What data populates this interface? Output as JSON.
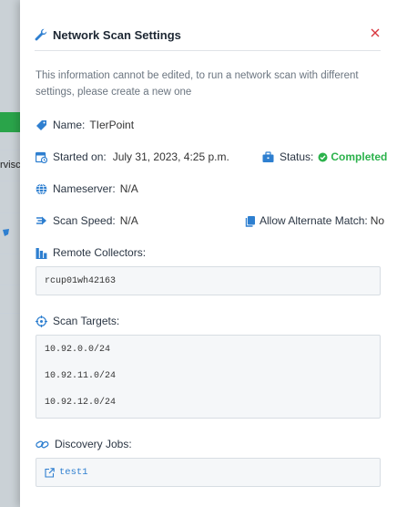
{
  "background": {
    "partial_text": "rvisc"
  },
  "panel": {
    "title": "Network Scan Settings",
    "close_glyph": "✕",
    "description": "This information cannot be edited, to run a network scan with different settings, please create a new one"
  },
  "fields": {
    "name": {
      "label": "Name:",
      "value": "TIerPoint"
    },
    "started_on": {
      "label": "Started on:",
      "value": "July 31, 2023, 4:25 p.m."
    },
    "status": {
      "label": "Status:",
      "value": "Completed"
    },
    "nameserver": {
      "label": "Nameserver:",
      "value": "N/A"
    },
    "scan_speed": {
      "label": "Scan Speed:",
      "value": "N/A"
    },
    "allow_alternate_match": {
      "label": "Allow Alternate Match:",
      "value": "No"
    },
    "remote_collectors": {
      "label": "Remote Collectors:",
      "items": [
        "rcup01wh42163"
      ]
    },
    "scan_targets": {
      "label": "Scan Targets:",
      "items": [
        "10.92.0.0/24",
        "10.92.11.0/24",
        "10.92.12.0/24"
      ]
    },
    "discovery_jobs": {
      "label": "Discovery Jobs:",
      "items": [
        "test1"
      ]
    }
  },
  "colors": {
    "accent": "#2e7fd0",
    "status_green": "#2cb24c",
    "close_red": "#d9363e"
  },
  "icons": [
    "wrench-icon",
    "close-icon",
    "tag-icon",
    "calendar-clock-icon",
    "briefcase-icon",
    "check-circle-icon",
    "globe-icon",
    "speed-icon",
    "copy-icon",
    "collectors-icon",
    "target-icon",
    "link-icon",
    "external-link-icon"
  ]
}
